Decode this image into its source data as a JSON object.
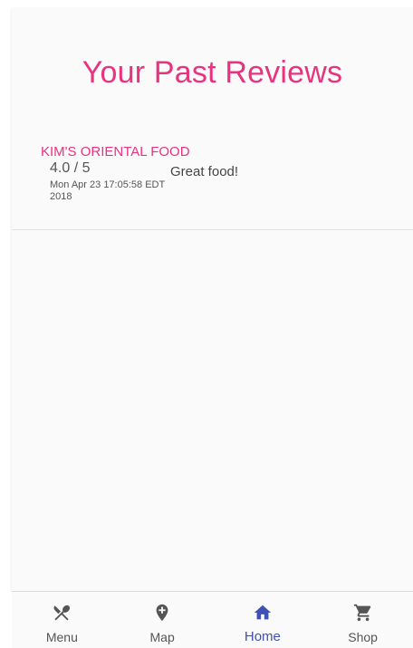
{
  "page": {
    "title": "Your Past Reviews"
  },
  "reviews": [
    {
      "restaurant": "KIM'S ORIENTAL FOOD",
      "rating": "4.0 / 5",
      "date": "Mon Apr 23 17:05:58 EDT 2018",
      "text": "Great food!"
    }
  ],
  "nav": {
    "items": [
      {
        "label": "Menu",
        "icon": "fork-knife-icon"
      },
      {
        "label": "Map",
        "icon": "map-pin-icon"
      },
      {
        "label": "Home",
        "icon": "home-icon",
        "active": true
      },
      {
        "label": "Shop",
        "icon": "cart-icon"
      }
    ]
  },
  "colors": {
    "accent": "#e8337f",
    "active_nav": "#3f51b5",
    "inactive_nav": "#555555"
  }
}
